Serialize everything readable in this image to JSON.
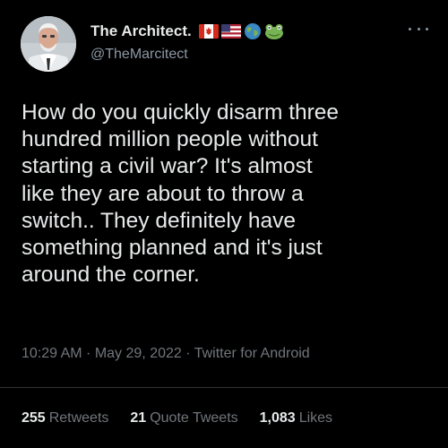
{
  "user": {
    "display_name": "The Architect.",
    "handle": "@TheMarcitect",
    "badges": [
      "canada-flag-icon",
      "usa-flag-icon",
      "globe-icon",
      "frog-icon"
    ]
  },
  "tweet": {
    "lines": [
      "How do you quickly disarm three",
      "hundred million people without",
      "starting a civil war? It's almost",
      "like they are about to throw a",
      "switch.. They definitely have",
      "something planned and it's just",
      "around the corner."
    ],
    "time": "10:29 AM",
    "separator": " · ",
    "date": "May 29, 2022",
    "source": "Twitter for Android"
  },
  "stats": {
    "retweets_count": "255",
    "retweets_label": "Retweets",
    "quotes_count": "21",
    "quotes_label": "Quote Tweets",
    "likes_count": "1,083",
    "likes_label": "Likes"
  },
  "colors": {
    "background": "#000000",
    "text": "#e7e9ea",
    "secondary": "#71767b",
    "divider": "#2f3336"
  }
}
